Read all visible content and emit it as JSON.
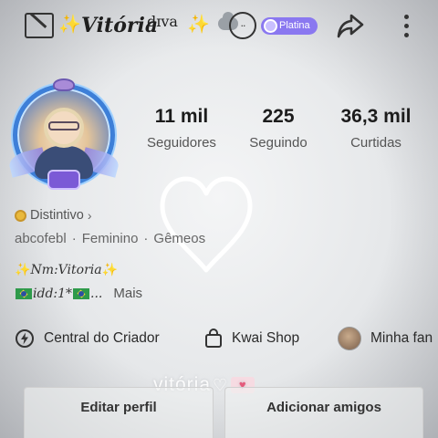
{
  "header": {
    "profile_name": "Vitória",
    "name_tag": "dɪva",
    "level_text": "..",
    "badge_label": "Platina",
    "sparkle_glyph": "✨"
  },
  "stats": [
    {
      "value": "11 mil",
      "label": "Seguidores"
    },
    {
      "value": "225",
      "label": "Seguindo"
    },
    {
      "value": "36,3 mil",
      "label": "Curtidas"
    }
  ],
  "profile": {
    "distintivo_label": "Distintivo",
    "distintivo_chevron": "›",
    "tags": [
      "abcofebl",
      "Feminino",
      "Gêmeos"
    ],
    "tag_separator": "·",
    "bio_line1": "Nm:Vitoria",
    "bio_line2_text": "idd:1*",
    "bio_ellipsis": "...",
    "more_label": "Mais"
  },
  "shortcuts": [
    {
      "label": "Central do Criador",
      "icon": "lightning-circle-icon"
    },
    {
      "label": "Kwai Shop",
      "icon": "shopping-bag-icon"
    },
    {
      "label": "Minha fan",
      "icon": "avatar-thumbnail"
    }
  ],
  "watermark": {
    "text": "vitória",
    "heart": "♡",
    "heart_box": "♥"
  },
  "buttons": {
    "edit_profile": "Editar perfil",
    "add_friends": "Adicionar amigos"
  },
  "colors": {
    "badge": "#8a78f0",
    "avatar_ring": "#3d7fd8",
    "sparkle": "#e3b53a"
  }
}
